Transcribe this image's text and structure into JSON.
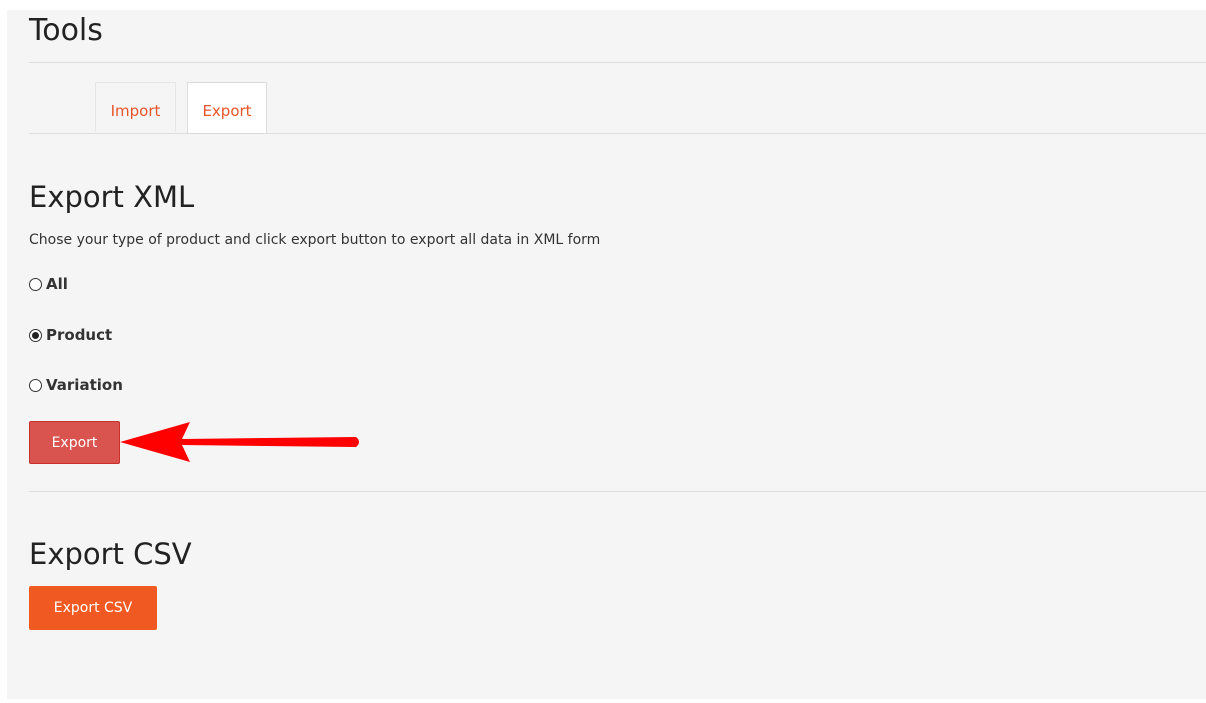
{
  "page": {
    "title": "Tools"
  },
  "tabs": [
    {
      "label": "Import"
    },
    {
      "label": "Export"
    }
  ],
  "export_xml": {
    "title": "Export XML",
    "description": "Chose your type of product and click export button to export all data in XML form",
    "options": [
      {
        "label": "All",
        "checked": false
      },
      {
        "label": "Product",
        "checked": true
      },
      {
        "label": "Variation",
        "checked": false
      }
    ],
    "button_label": "Export"
  },
  "export_csv": {
    "title": "Export CSV",
    "button_label": "Export CSV"
  },
  "colors": {
    "tab_text": "#e8542a",
    "export_button": "#d9534f",
    "export_csv_button": "#f05a22",
    "annotation_arrow": "#ff0000",
    "panel_background": "#f5f5f5"
  }
}
